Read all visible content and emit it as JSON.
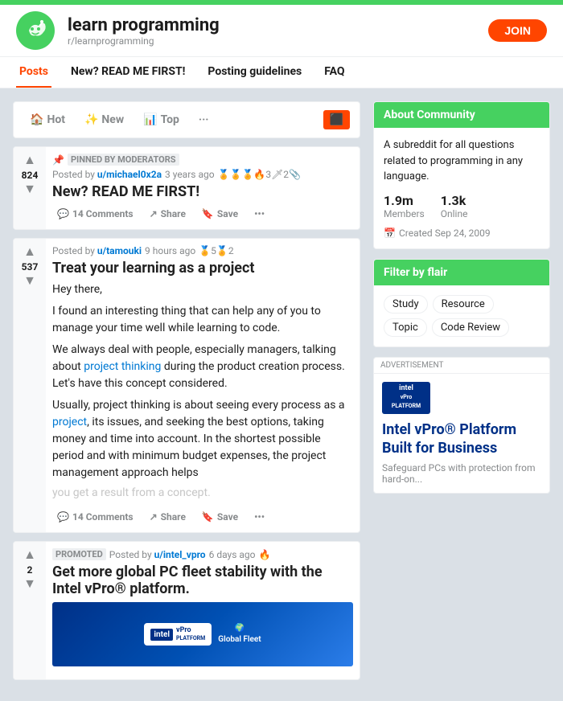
{
  "topbar": {
    "color": "#46d160"
  },
  "header": {
    "title": "learn programming",
    "subreddit": "r/learnprogramming",
    "join_label": "JOIN"
  },
  "subnav": {
    "items": [
      {
        "label": "Posts",
        "active": true
      },
      {
        "label": "New? READ ME FIRST!"
      },
      {
        "label": "Posting guidelines"
      },
      {
        "label": "FAQ"
      }
    ]
  },
  "sort_bar": {
    "items": [
      {
        "label": "Hot",
        "icon": "🏠",
        "active": false
      },
      {
        "label": "New",
        "icon": "✨",
        "active": false
      },
      {
        "label": "Top",
        "icon": "📊",
        "active": false
      },
      {
        "label": "···",
        "active": false
      }
    ]
  },
  "posts": [
    {
      "id": "pinned",
      "pinned": true,
      "votes": "824",
      "meta": "PINNED BY MODERATORS",
      "author": "u/michael0x2a",
      "time": "3 years ago",
      "awards": "🏅🏅🏅🔥3🗡2📎",
      "title": "New? READ ME FIRST!",
      "comments": "14 Comments",
      "share": "Share",
      "save": "Save"
    },
    {
      "id": "main",
      "votes": "537",
      "author": "u/tamouki",
      "time": "9 hours ago",
      "awards": "🏅5🏅2",
      "title": "Treat your learning as a project",
      "body_p1": "Hey there,",
      "body_p2": "I found an interesting thing that can help any of you to manage your time well while learning to code.",
      "body_p3_before": "We always deal with people, especially managers, talking about ",
      "body_p3_link": "project thinking",
      "body_p3_after": " during the product creation process. Let's have this concept considered.",
      "body_p4_before": "Usually, project thinking is about seeing every process as a ",
      "body_p4_link": "project",
      "body_p4_after": ", its issues, and seeking the best options, taking money and time into account. In the shortest possible period and with minimum budget expenses, the project management approach helps",
      "body_faded": "you get a result from a concept.",
      "comments": "14 Comments",
      "share": "Share",
      "save": "Save"
    },
    {
      "id": "promo",
      "promoted": true,
      "votes": "2",
      "author": "u/intel_vpro",
      "time": "6 days ago",
      "title": "Get more global PC fleet stability with the Intel vPro® platform.",
      "comments": "",
      "share": "",
      "save": ""
    }
  ],
  "sidebar": {
    "about_header": "About Community",
    "about_desc": "A subreddit for all questions related to programming in any language.",
    "members": "1.9m",
    "members_label": "Members",
    "online": "1.3k",
    "online_label": "Online",
    "created": "Created Sep 24, 2009",
    "filter_header": "Filter by flair",
    "filter_tags": [
      "Study",
      "Resource",
      "Topic",
      "Code Review"
    ],
    "ad_label": "ADVERTISEMENT",
    "ad_title": "Intel vPro® Platform Built for Business",
    "ad_desc": "Safeguard PCs with protection from hard-on..."
  }
}
